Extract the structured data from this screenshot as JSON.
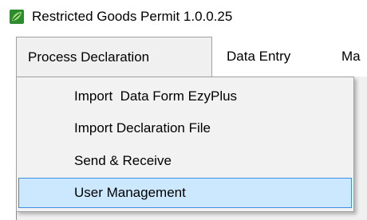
{
  "window": {
    "title": "Restricted Goods Permit 1.0.0.25",
    "icon": "app-leaf-icon"
  },
  "menubar": {
    "items": [
      {
        "label": "Process Declaration",
        "active": true
      },
      {
        "label": "Data Entry",
        "active": false
      },
      {
        "label": "Ma",
        "active": false
      }
    ]
  },
  "dropdown": {
    "items": [
      {
        "label": "Import  Data Form EzyPlus",
        "highlighted": false
      },
      {
        "label": "Import Declaration File",
        "highlighted": false
      },
      {
        "label": "Send & Receive",
        "highlighted": false
      },
      {
        "label": "User Management",
        "highlighted": true
      }
    ]
  },
  "colors": {
    "highlight_bg": "#cce8ff",
    "highlight_border": "#3d8ee2",
    "menu_bg": "#f2f2f2"
  }
}
